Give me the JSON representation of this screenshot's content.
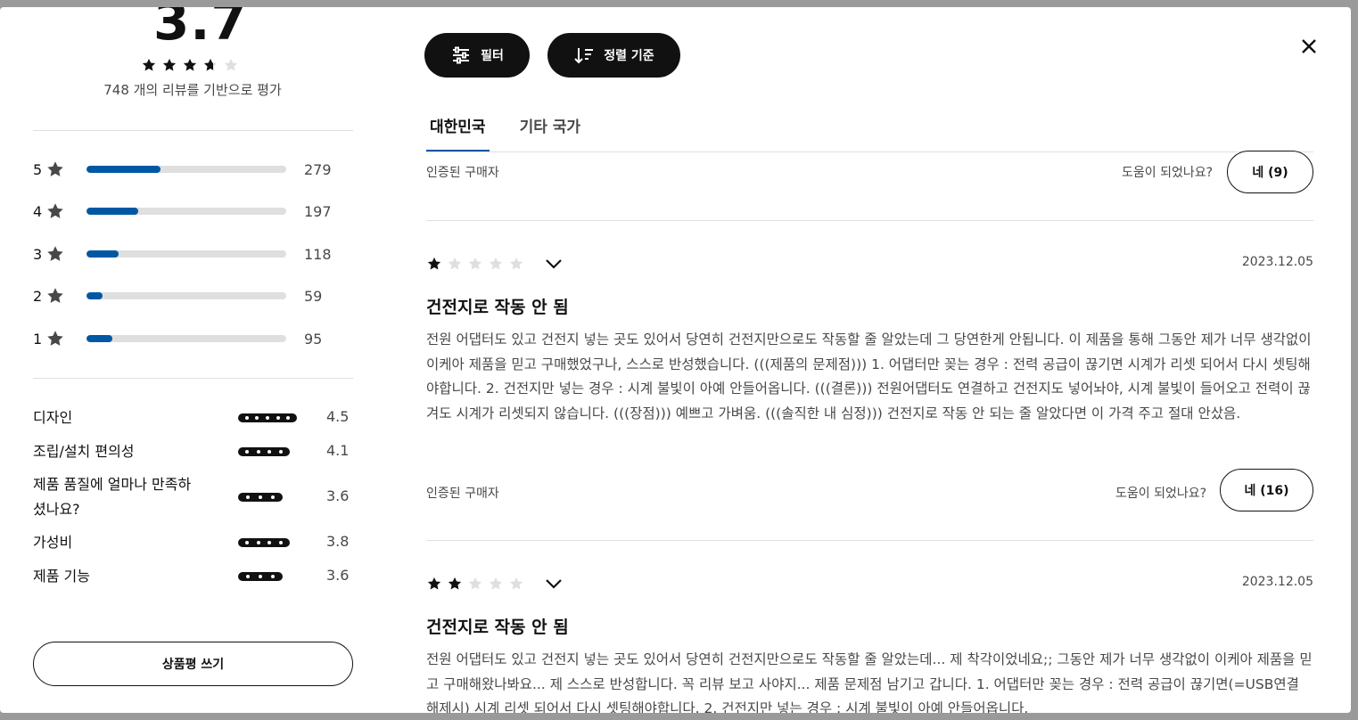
{
  "summary": {
    "rating": "3.7",
    "rating_value": 3.7,
    "review_count_text": "748 개의 리뷰를 기반으로 평가"
  },
  "distribution": [
    {
      "stars": "5",
      "count": "279",
      "fraction": 0.37
    },
    {
      "stars": "4",
      "count": "197",
      "fraction": 0.26
    },
    {
      "stars": "3",
      "count": "118",
      "fraction": 0.16
    },
    {
      "stars": "2",
      "count": "59",
      "fraction": 0.08
    },
    {
      "stars": "1",
      "count": "95",
      "fraction": 0.13
    }
  ],
  "attributes": [
    {
      "label": "디자인",
      "value": "4.5",
      "dots": 5
    },
    {
      "label": "조립/설치 편의성",
      "value": "4.1",
      "dots": 4
    },
    {
      "label": "제품 품질에 얼마나 만족하셨나요?",
      "value": "3.6",
      "dots": 3
    },
    {
      "label": "가성비",
      "value": "3.8",
      "dots": 4
    },
    {
      "label": "제품 기능",
      "value": "3.6",
      "dots": 3
    }
  ],
  "write_review_label": "상품평 쓰기",
  "toolbar": {
    "filter_label": "필터",
    "sort_label": "정렬 기준"
  },
  "tabs": [
    {
      "label": "대한민국",
      "active": true
    },
    {
      "label": "기타 국가",
      "active": false
    }
  ],
  "prev_review": {
    "verified": "인증된 구매자",
    "helpful_question": "도움이 되었나요?",
    "helpful_button": "네 (9)"
  },
  "reviews": [
    {
      "stars": 1,
      "date": "2023.12.05",
      "title": "건전지로 작동 안 됨",
      "body": "전원 어댑터도 있고 건전지 넣는 곳도 있어서 당연히 건전지만으로도 작동할 줄 알았는데 그 당연한게 안됩니다. 이 제품을 통해 그동안 제가 너무 생각없이 이케아 제품을 믿고 구매했었구나, 스스로 반성했습니다. (((제품의 문제점))) 1. 어댑터만 꽂는 경우 : 전력 공급이 끊기면 시계가 리셋 되어서 다시 셋팅해야합니다. 2. 건전지만 넣는 경우 : 시계 불빛이 아예 안들어옵니다. (((결론))) 전원어댑터도 연결하고 건전지도 넣어놔야, 시계 불빛이 들어오고 전력이 끊겨도 시계가 리셋되지 않습니다. (((장점))) 예쁘고 가벼움. (((솔직한 내 심정))) 건전지로 작동 안 되는 줄 알았다면 이 가격 주고 절대 안샀음.",
      "verified": "인증된 구매자",
      "helpful_question": "도움이 되었나요?",
      "helpful_button": "네 (16)"
    },
    {
      "stars": 2,
      "date": "2023.12.05",
      "title": "건전지로 작동 안 됨",
      "body": "전원 어댑터도 있고 건전지 넣는 곳도 있어서 당연히 건전지만으로도 작동할 줄 알았는데... 제 착각이었네요;; 그동안 제가 너무 생각없이 이케아 제품을 믿고 구매해왔나봐요... 제 스스로 반성합니다. 꼭 리뷰 보고 사야지... 제품 문제점 남기고 갑니다. 1. 어댑터만 꽂는 경우 : 전력 공급이 끊기면(=USB연결 해제시) 시계 리셋 되어서 다시 셋팅해야합니다. 2. 건전지만 넣는 경우 : 시계 불빛이 아예 안들어옵니다."
    }
  ],
  "colors": {
    "accent": "#0058a3",
    "bar_track": "#dfdfdf",
    "dark": "#111111",
    "muted_text": "#484848",
    "empty_star": "#dfdfdf"
  },
  "icons": {
    "filter": "sliders-icon",
    "sort": "sort-icon",
    "close": "close-icon",
    "expand": "chevron-down-icon",
    "star": "star-icon"
  }
}
